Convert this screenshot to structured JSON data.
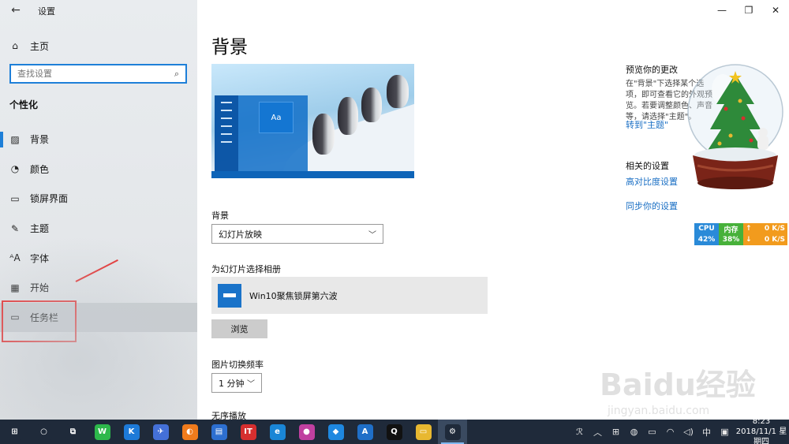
{
  "app": {
    "title": "设置",
    "back_label": "←"
  },
  "sidebar": {
    "home_label": "主页",
    "search_placeholder": "查找设置",
    "section": "个性化",
    "items": [
      {
        "label": "背景",
        "icon": "picture-icon"
      },
      {
        "label": "颜色",
        "icon": "palette-icon"
      },
      {
        "label": "锁屏界面",
        "icon": "monitor-lock-icon"
      },
      {
        "label": "主题",
        "icon": "theme-brush-icon"
      },
      {
        "label": "字体",
        "icon": "font-icon"
      },
      {
        "label": "开始",
        "icon": "start-grid-icon"
      },
      {
        "label": "任务栏",
        "icon": "taskbar-icon"
      }
    ],
    "selected_index": 0,
    "hover_index": 6
  },
  "main": {
    "title": "背景",
    "preview_tile": "Aa",
    "background_label": "背景",
    "background_value": "幻灯片放映",
    "album_label": "为幻灯片选择相册",
    "album_name": "Win10聚焦锁屏第六波",
    "browse_label": "浏览",
    "interval_label": "图片切换频率",
    "interval_value": "1 分钟",
    "shuffle_label": "无序播放"
  },
  "right": {
    "preview_title": "预览你的更改",
    "preview_desc": "在\"背景\"下选择某个选项，即可查看它的外观预览。若要调整颜色、声音等，请选择\"主题\"。",
    "theme_link": "转到\"主题\"",
    "related_title": "相关的设置",
    "contrast_link": "高对比度设置",
    "sync_link": "同步你的设置"
  },
  "widget": {
    "cpu_label": "CPU",
    "cpu_value": "42%",
    "mem_label": "内存",
    "mem_value": "38%",
    "up_value": "0 K/S",
    "down_value": "0 K/S"
  },
  "taskbar": {
    "apps": [
      {
        "name": "start-button",
        "glyph": "⊞",
        "color": "#1f2a3a"
      },
      {
        "name": "search-button",
        "glyph": "○",
        "color": "#1f2a3a"
      },
      {
        "name": "task-view-button",
        "glyph": "⧉",
        "color": "#1f2a3a"
      },
      {
        "name": "wechat-app",
        "glyph": "W",
        "color": "#2db84b"
      },
      {
        "name": "k-app",
        "glyph": "K",
        "color": "#1d7ad8"
      },
      {
        "name": "feishu-app",
        "glyph": "✈",
        "color": "#4470d8"
      },
      {
        "name": "firefox-app",
        "glyph": "◐",
        "color": "#f07b1c"
      },
      {
        "name": "office-app",
        "glyph": "▤",
        "color": "#2d6fd0"
      },
      {
        "name": "red-app",
        "glyph": "IT",
        "color": "#d62f2f"
      },
      {
        "name": "ie-browser-app",
        "glyph": "e",
        "color": "#1a86d6"
      },
      {
        "name": "color-wheel-app",
        "glyph": "●",
        "color": "#c040a0"
      },
      {
        "name": "blue-bird-app",
        "glyph": "◆",
        "color": "#1e88e0"
      },
      {
        "name": "apps-store-app",
        "glyph": "A",
        "color": "#1f6fc8"
      },
      {
        "name": "qq-app",
        "glyph": "Q",
        "color": "#111111"
      },
      {
        "name": "file-explorer-app",
        "glyph": "▭",
        "color": "#e8b830"
      },
      {
        "name": "settings-app",
        "glyph": "⚙",
        "color": "#1f2a3a"
      }
    ],
    "active_index": 15,
    "tray_icons": [
      "person-icon",
      "chevron-up-icon",
      "grid-icon",
      "tray-app-icon",
      "battery-icon",
      "wifi-icon",
      "volume-icon",
      "ime-icon",
      "ime-mode-icon"
    ],
    "tray_glyphs": [
      "ℛ",
      "︿",
      "⊞",
      "◍",
      "▭",
      "◠",
      "◁)",
      "中",
      "▣"
    ],
    "ime_label": "中",
    "time": "8:23",
    "date": "2018/11/1 星期四"
  },
  "watermark": {
    "text": "Baidu经验",
    "sub": "jingyan.baidu.com"
  }
}
